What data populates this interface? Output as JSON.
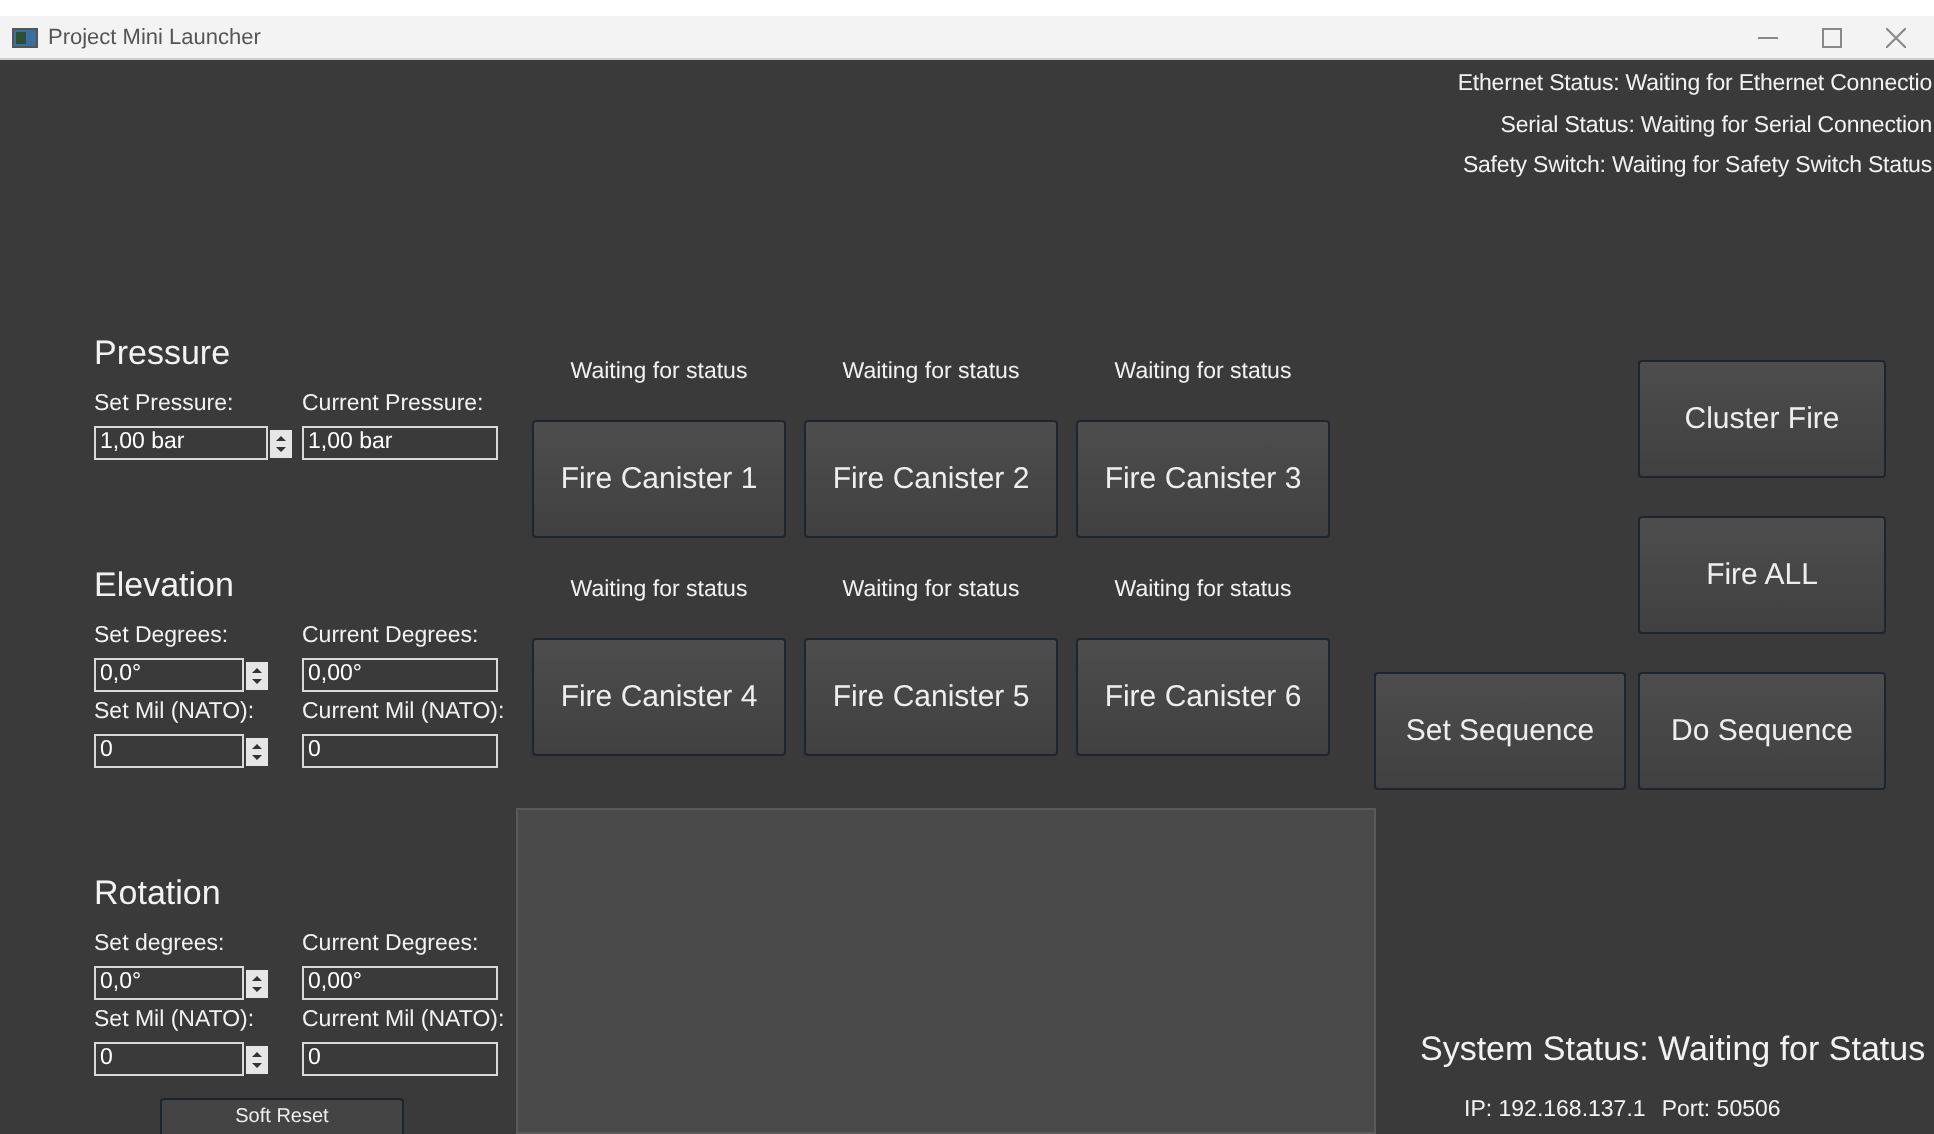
{
  "window": {
    "title": "Project Mini Launcher"
  },
  "connection_status": [
    "Ethernet Status: Waiting for Ethernet Connectio",
    "Serial Status: Waiting for Serial Connection",
    "Safety Switch: Waiting for Safety Switch Status"
  ],
  "sections": [
    {
      "heading": "Pressure",
      "fields": [
        {
          "set_label": "Set Pressure:",
          "set_value": "1,00 bar",
          "current_label": "Current Pressure:",
          "current_value": "1,00 bar"
        }
      ]
    },
    {
      "heading": "Elevation",
      "fields": [
        {
          "set_label": "Set Degrees:",
          "set_value": "0,0°",
          "current_label": "Current Degrees:",
          "current_value": "0,00°"
        },
        {
          "set_label": "Set Mil (NATO):",
          "set_value": "0",
          "current_label": "Current Mil (NATO):",
          "current_value": "0"
        }
      ]
    },
    {
      "heading": "Rotation",
      "fields": [
        {
          "set_label": "Set degrees:",
          "set_value": "0,0°",
          "current_label": "Current Degrees:",
          "current_value": "0,00°"
        },
        {
          "set_label": "Set Mil (NATO):",
          "set_value": "0",
          "current_label": "Current Mil (NATO):",
          "current_value": "0"
        }
      ]
    }
  ],
  "soft_reset": "Soft Reset",
  "canisters": [
    {
      "status": "Waiting for status",
      "button": "Fire Canister 1"
    },
    {
      "status": "Waiting for status",
      "button": "Fire Canister 2"
    },
    {
      "status": "Waiting for status",
      "button": "Fire Canister 3"
    },
    {
      "status": "Waiting for status",
      "button": "Fire Canister 4"
    },
    {
      "status": "Waiting for status",
      "button": "Fire Canister 5"
    },
    {
      "status": "Waiting for status",
      "button": "Fire Canister 6"
    }
  ],
  "actions": {
    "cluster_fire": "Cluster Fire",
    "fire_all": "Fire ALL",
    "set_sequence": "Set Sequence",
    "do_sequence": "Do Sequence"
  },
  "system_status": "System Status: Waiting for Status",
  "ip": "IP: 192.168.137.1",
  "port": "Port: 50506"
}
